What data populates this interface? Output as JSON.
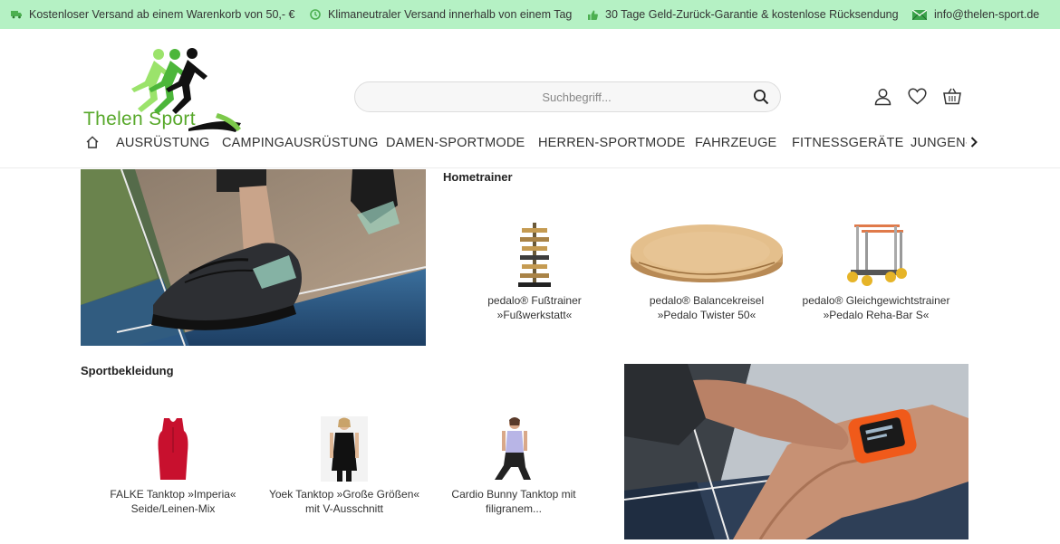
{
  "topbar": {
    "items": [
      {
        "icon": "truck-icon",
        "text": "Kostenloser Versand ab einem Warenkorb von 50,- €"
      },
      {
        "icon": "clock-icon",
        "text": "Klimaneutraler Versand innerhalb von einem Tag"
      },
      {
        "icon": "thumbs-up-icon",
        "text": "30 Tage Geld-Zurück-Garantie & kostenlose Rücksendung"
      },
      {
        "icon": "mail-icon",
        "text": "info@thelen-sport.de"
      }
    ],
    "background": "#b5f1c4"
  },
  "header": {
    "logo_text": "Thelen Sport",
    "search_placeholder": "Suchbegriff...",
    "icons": [
      "user-icon",
      "heart-icon",
      "cart-icon"
    ]
  },
  "nav": {
    "items": [
      "AUSRÜSTUNG",
      "CAMPINGAUSRÜSTUNG",
      "DAMEN-SPORTMODE",
      "HERREN-SPORTMODE",
      "FAHRZEUGE",
      "FITNESSGERÄTE",
      "JUNGEN-SPORTMODE"
    ]
  },
  "hometrainer": {
    "title": "Hometrainer",
    "products": [
      {
        "line1": "pedalo® Fußtrainer",
        "line2": "»Fußwerkstatt«"
      },
      {
        "line1": "pedalo® Balancekreisel",
        "line2": "»Pedalo Twister 50«"
      },
      {
        "line1": "pedalo® Gleichgewichtstrainer",
        "line2": "»Pedalo Reha-Bar S«"
      }
    ]
  },
  "sportbekleidung": {
    "title": "Sportbekleidung",
    "products": [
      {
        "line1": "FALKE Tanktop »Imperia«",
        "line2": "Seide/Leinen-Mix"
      },
      {
        "line1": "Yoek Tanktop »Große Größen«",
        "line2": "mit V-Ausschnitt"
      },
      {
        "line1": "Cardio Bunny Tanktop mit",
        "line2": "filigranem..."
      }
    ]
  },
  "colors": {
    "brand_green": "#57a82a",
    "topbar": "#b5f1c4"
  }
}
